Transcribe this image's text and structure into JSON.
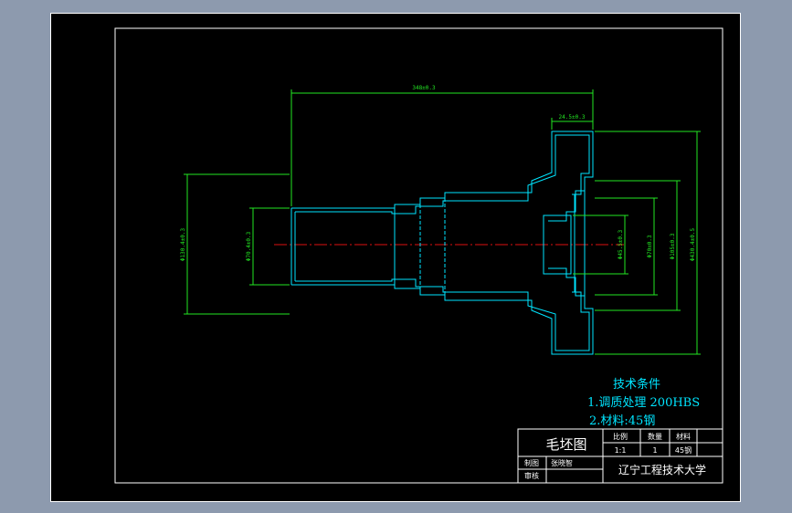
{
  "dimensions": {
    "overall_length": "348±0.3",
    "flange_thickness": "24.5±0.3",
    "left_bore_dia": "Φ70.4±0.3",
    "left_outer_dia": "Φ130.4±0.3",
    "right_bore_dia": "Φ45.5±0.3",
    "step_dia_1": "Φ70±0.3",
    "step_dia_2": "Φ105±0.3",
    "flange_dia": "Φ430.4±0.5"
  },
  "tech_requirements": {
    "title": "技术条件",
    "item1": "1.调质处理 200HBS",
    "item2": "2.材料:45钢"
  },
  "title_block": {
    "drawing_name": "毛坯图",
    "scale_label": "比例",
    "quantity_label": "数量",
    "material_label": "材料",
    "scale_value": "1:1",
    "quantity_value": "1",
    "material_value": "45钢",
    "drawn_by_label": "制图",
    "drawn_by_value": "张晓智",
    "checked_by_label": "审核",
    "institution": "辽宁工程技术大学"
  },
  "colors": {
    "outline": "#00e5ff",
    "dimension": "#22e622",
    "centerline": "#dd1111",
    "border": "#ffffff",
    "text": "#00e5ff"
  }
}
